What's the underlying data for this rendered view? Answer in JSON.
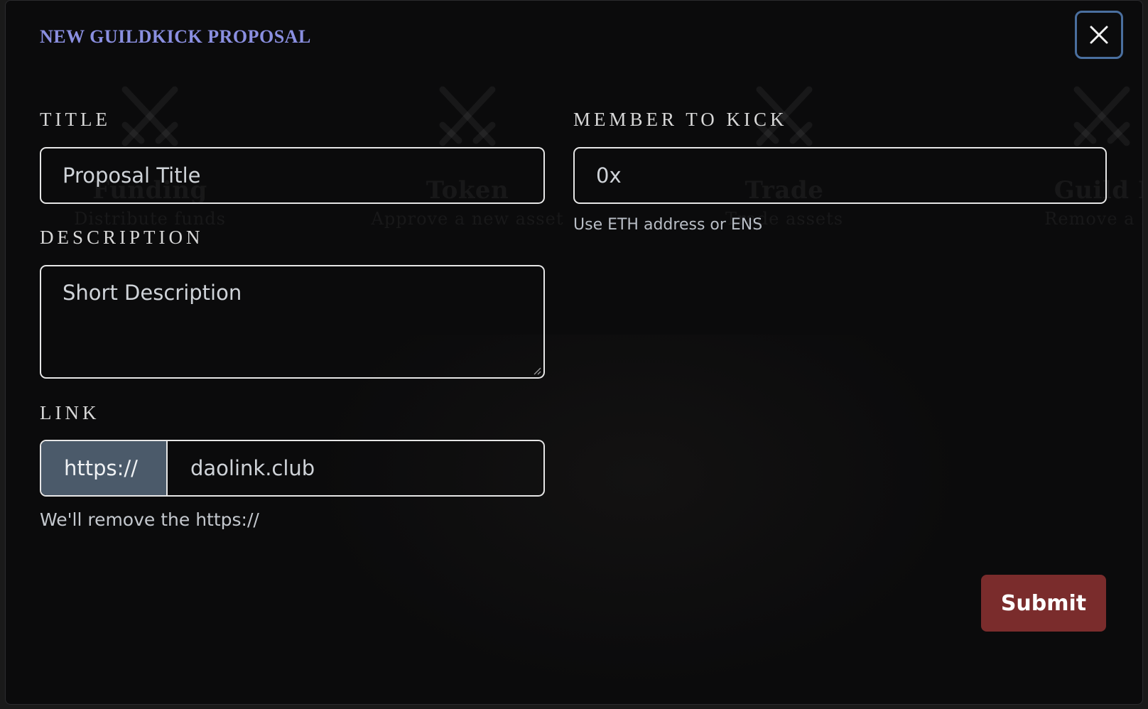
{
  "modal": {
    "title": "NEW GUILDKICK PROPOSAL",
    "close_icon": "close-icon"
  },
  "background": {
    "icon": "crossed-swords-icon",
    "cards": [
      {
        "title": "Funding",
        "subtitle": "Distribute funds"
      },
      {
        "title": "Token",
        "subtitle": "Approve a new asset"
      },
      {
        "title": "Trade",
        "subtitle": "Trade assets"
      },
      {
        "title": "Guild I",
        "subtitle": "Remove a M"
      }
    ]
  },
  "form": {
    "title_label": "TITLE",
    "title_placeholder": "Proposal Title",
    "member_label": "MEMBER TO KICK",
    "member_placeholder": "0x",
    "member_helper": "Use ETH address or ENS",
    "description_label": "DESCRIPTION",
    "description_placeholder": "Short Description",
    "link_label": "LINK",
    "link_prefix": "https://",
    "link_placeholder": "daolink.club",
    "link_helper": "We'll remove the https://",
    "submit_label": "Submit"
  },
  "colors": {
    "title_accent": "#8a8fe0",
    "submit_bg": "#7a2c2c",
    "addon_bg": "#4b5a6a",
    "close_border": "#4a6f9f"
  }
}
